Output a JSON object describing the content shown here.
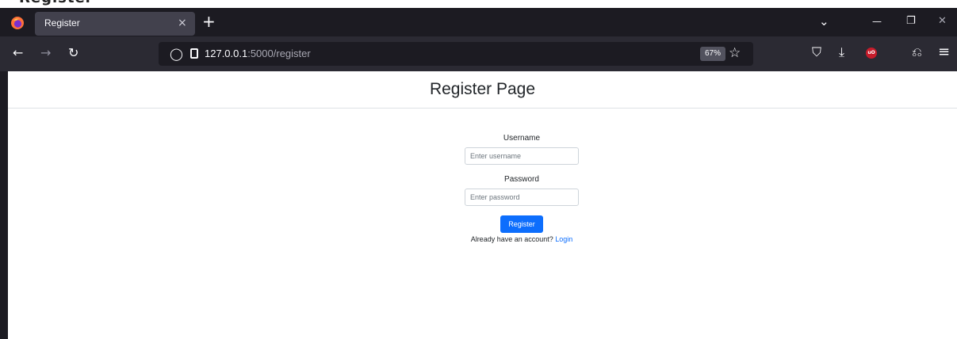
{
  "page_header": {
    "text": "Register Page"
  },
  "browser": {
    "tab_title": "Register",
    "url_host": "127.0.0.1",
    "url_path": ":5000/register",
    "zoom": "67%"
  },
  "icons": {
    "close_tab": "×",
    "new_tab": "+",
    "list_tabs": "⌄",
    "minimize": "—",
    "restore": "❐",
    "close_window": "✕",
    "back": "←",
    "forward": "→",
    "reload": "↻",
    "shield": "◯",
    "bookmark": "☆",
    "pocket": "⛉",
    "download": "⤓",
    "ublock": "uO",
    "extensions": "⎌",
    "menu": "≡"
  },
  "page": {
    "title": "Register Page",
    "username_label": "Username",
    "username_placeholder": "Enter username",
    "password_label": "Password",
    "password_placeholder": "Enter password",
    "register_button": "Register",
    "already_text": "Already have an account? ",
    "login_link": "Login"
  },
  "colors": {
    "browser_tabbar": "#1c1b22",
    "browser_toolbar": "#2b2a33",
    "primary": "#0d6efd",
    "ublock_red": "#c61c2b"
  }
}
